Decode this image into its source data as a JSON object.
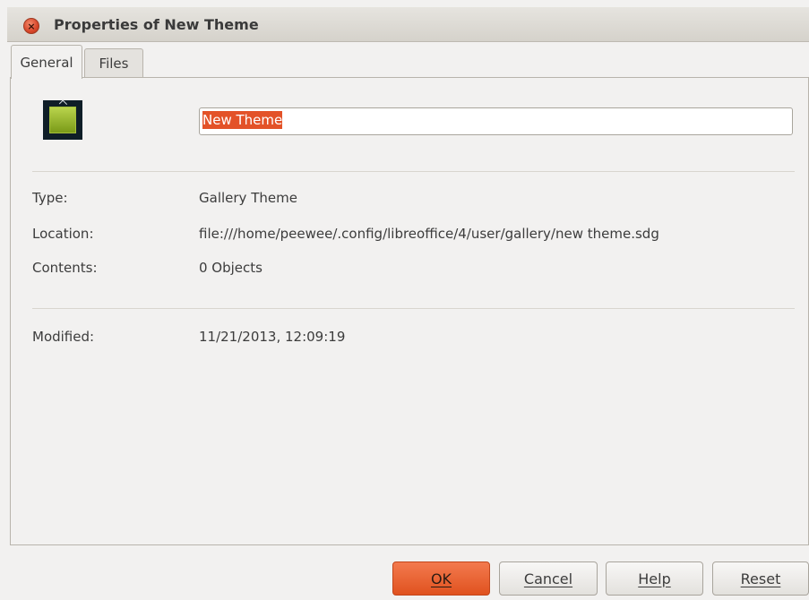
{
  "window": {
    "title": "Properties of New Theme",
    "close_glyph": "×"
  },
  "tabs": [
    {
      "label": "General",
      "active": true
    },
    {
      "label": "Files",
      "active": false
    }
  ],
  "general": {
    "icon": "gallery-theme-icon",
    "name_value": "New Theme",
    "type_label": "Type:",
    "type_value": "Gallery Theme",
    "location_label": "Location:",
    "location_value": "file:///home/peewee/.config/libreoffice/4/user/gallery/new theme.sdg",
    "contents_label": "Contents:",
    "contents_value": "0 Objects",
    "modified_label": "Modified:",
    "modified_value": "11/21/2013, 12:09:19"
  },
  "buttons": {
    "ok": "OK",
    "cancel": "Cancel",
    "help": "Help",
    "reset": "Reset"
  },
  "colors": {
    "accent": "#e35228",
    "background": "#f2f1f0"
  }
}
